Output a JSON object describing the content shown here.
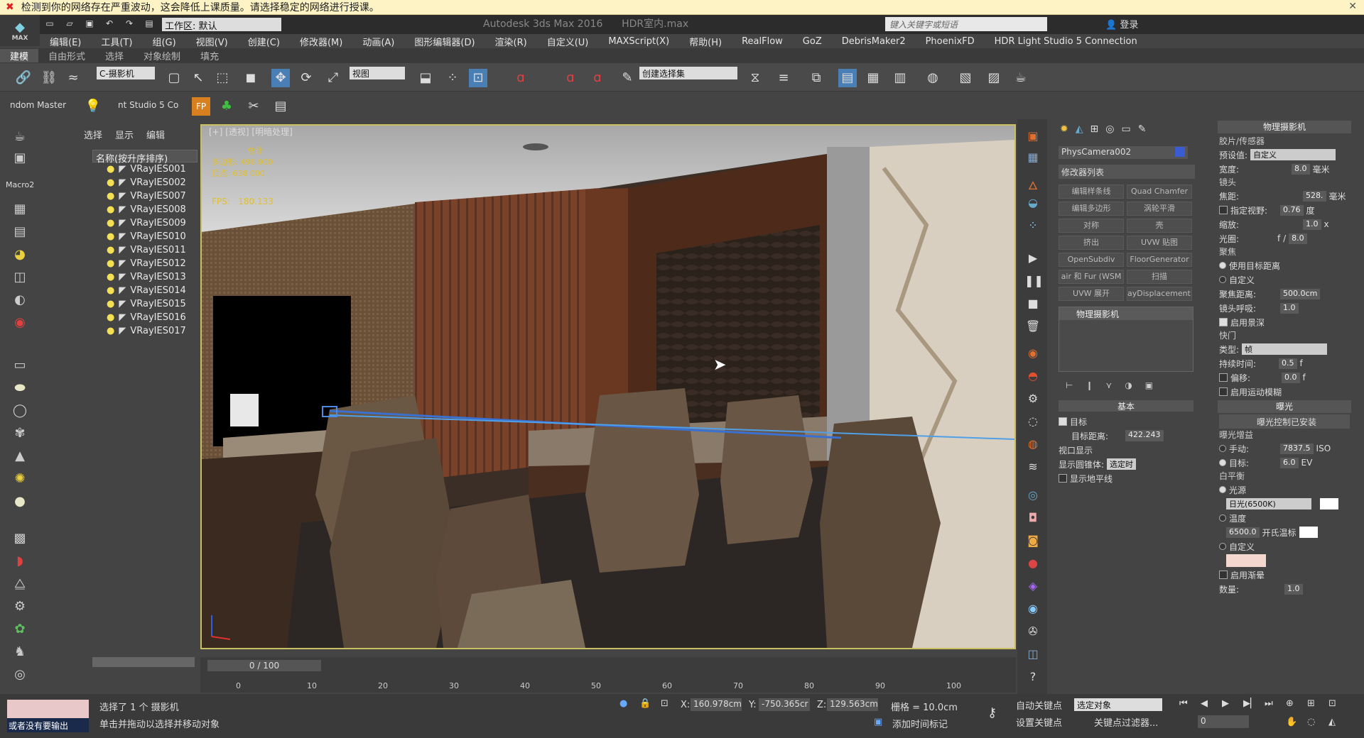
{
  "notice": {
    "text": "检测到你的网络存在严重波动，这会降低上课质量。请选择稳定的网络进行授课。",
    "close": "✕"
  },
  "app": {
    "title": "Autodesk 3ds Max 2016",
    "file": "HDR室内.max",
    "logo": "MAX"
  },
  "workspace": "工作区: 默认",
  "search_placeholder": "键入关键字或短语",
  "login": "登录",
  "menus": [
    "编辑(E)",
    "工具(T)",
    "组(G)",
    "视图(V)",
    "创建(C)",
    "修改器(M)",
    "动画(A)",
    "图形编辑器(D)",
    "渲染(R)",
    "自定义(U)",
    "MAXScript(X)",
    "帮助(H)",
    "RealFlow",
    "GoZ",
    "DebrisMaker2",
    "PhoenixFD",
    "HDR Light Studio 5 Connection"
  ],
  "ribbon_tabs": [
    "建模",
    "自由形式",
    "选择",
    "对象绘制",
    "填充"
  ],
  "toolbar": {
    "filter": "C-摄影机",
    "view": "视图",
    "selection_set": "创建选择集",
    "random_master": "ndom Master",
    "studio": "nt Studio 5 Co"
  },
  "leftstrip": {
    "macro": "Macro2"
  },
  "scene_explorer": {
    "tabs": [
      "选择",
      "显示",
      "编辑"
    ],
    "column": "名称(按升序排序)",
    "items": [
      "VRayIES001",
      "VRayIES002",
      "VRayIES007",
      "VRayIES008",
      "VRayIES009",
      "VRayIES010",
      "VRayIES011",
      "VRayIES012",
      "VRayIES013",
      "VRayIES014",
      "VRayIES015",
      "VRayIES016",
      "VRayIES017"
    ]
  },
  "viewport": {
    "label": "[+] [透视] [明暗处理]",
    "stats_title": "总计",
    "polys_label": "多边形:",
    "polys": "496 000",
    "verts_label": "顶点:",
    "verts": "638 000",
    "fps_label": "FPS:",
    "fps": "180.133"
  },
  "timeline": {
    "frame": "0 / 100",
    "ticks": [
      "0",
      "10",
      "20",
      "30",
      "40",
      "50",
      "60",
      "70",
      "80",
      "90",
      "100"
    ]
  },
  "command_panel": {
    "object_name": "PhysCamera002",
    "modifier_list": "修改器列表",
    "modifiers": [
      "编辑样条线",
      "Quad Chamfer",
      "编辑多边形",
      "涡轮平滑",
      "对称",
      "壳",
      "挤出",
      "UVW 贴图",
      "OpenSubdiv",
      "FloorGenerator",
      "air 和 Fur (WSM",
      "扫描",
      "UVW 展开",
      "ayDisplacementM"
    ],
    "stack_item": "物理摄影机",
    "basic": "基本",
    "target": "目标",
    "target_distance_label": "目标距离:",
    "target_distance": "422.243",
    "viewport_display": "视口显示",
    "show_cone_label": "显示圆锥体:",
    "show_cone": "选定时",
    "show_horizon": "显示地平线"
  },
  "phys_camera": {
    "title": "物理摄影机",
    "film": "胶片/传感器",
    "preset_label": "预设值:",
    "preset": "自定义",
    "width_label": "宽度:",
    "width": "8.0",
    "width_unit": "毫米",
    "lens": "镜头",
    "focal_label": "焦距:",
    "focal": "528.",
    "focal_unit": "毫米",
    "fov_label": "指定视野:",
    "fov": "0.76",
    "fov_unit": "度",
    "zoom_label": "缩放:",
    "zoom": "1.0",
    "zoom_unit": "x",
    "aperture_label": "光圈:",
    "aperture_f": "f /",
    "aperture": "8.0",
    "focus": "聚焦",
    "use_target": "使用目标距离",
    "custom": "自定义",
    "focus_dist_label": "聚焦距离:",
    "focus_dist": "500.0cm",
    "breath_label": "镜头呼吸:",
    "breath": "1.0",
    "dof": "启用景深",
    "shutter": "快门",
    "type_label": "类型:",
    "type": "帧",
    "duration_label": "持续时间:",
    "duration": "0.5",
    "duration_unit": "f",
    "offset_label": "偏移:",
    "offset": "0.0",
    "offset_unit": "f",
    "motion_blur": "启用运动模糊",
    "exposure": "曝光",
    "exposure_control": "曝光控制已安装",
    "gain": "曝光增益",
    "manual_label": "手动:",
    "manual": "7837.5",
    "manual_unit": "ISO",
    "target_label": "目标:",
    "target": "6.0",
    "target_unit": "EV",
    "wb": "白平衡",
    "illuminant": "光源",
    "daylight": "日光(6500K)",
    "temp": "温度",
    "temp_value": "6500.0",
    "kelvin": "开氏温标",
    "custom2": "自定义",
    "vignette": "启用渐晕",
    "amount_label": "数量:",
    "amount": "1.0"
  },
  "status": {
    "selected": "选择了 1 个 摄影机",
    "hint": "单击并拖动以选择并移动对象",
    "left_box": "或者没有要输出",
    "x_label": "X:",
    "x": "160.978cm",
    "y_label": "Y:",
    "y": "-750.365cr",
    "z_label": "Z:",
    "z": "129.563cm",
    "grid": "栅格 = 10.0cm",
    "autokey": "自动关键点",
    "selected_obj": "选定对象",
    "setkey": "设置关键点",
    "keyfilter": "关键点过滤器...",
    "addtime": "添加时间标记",
    "frame_input": "0"
  }
}
